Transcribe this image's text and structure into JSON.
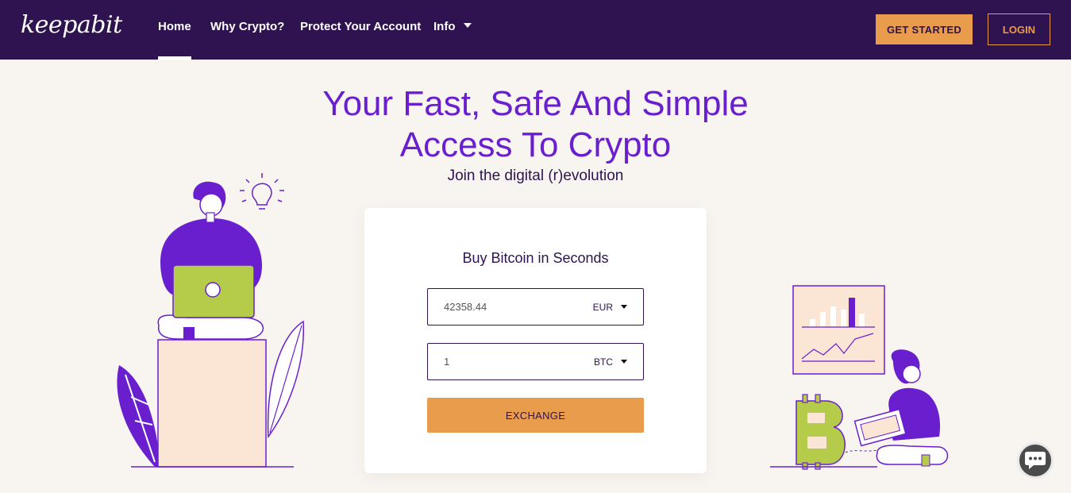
{
  "brand": {
    "logo_text": "keepabit"
  },
  "nav": {
    "links": [
      {
        "label": "Home",
        "active": true
      },
      {
        "label": "Why Crypto?"
      },
      {
        "label": "Protect Your Account"
      },
      {
        "label": "Info",
        "has_dropdown": true
      }
    ],
    "get_started": "GET STARTED",
    "login": "LOGIN"
  },
  "hero": {
    "title_line1": "Your Fast, Safe And Simple",
    "title_line2": "Access To Crypto",
    "subtitle": "Join the digital (r)evolution"
  },
  "exchange": {
    "title": "Buy Bitcoin in Seconds",
    "from": {
      "value": "42358.44",
      "currency": "EUR"
    },
    "to": {
      "value": "1",
      "currency": "BTC"
    },
    "button": "EXCHANGE"
  },
  "colors": {
    "nav_bg": "#2e1350",
    "accent_orange": "#e99c4b",
    "brand_purple": "#6a1fcf",
    "page_bg": "#f8f5f1"
  },
  "icons": [
    "chevron-down-icon",
    "chat-bubble-icon",
    "lightbulb-icon",
    "bitcoin-icon"
  ]
}
